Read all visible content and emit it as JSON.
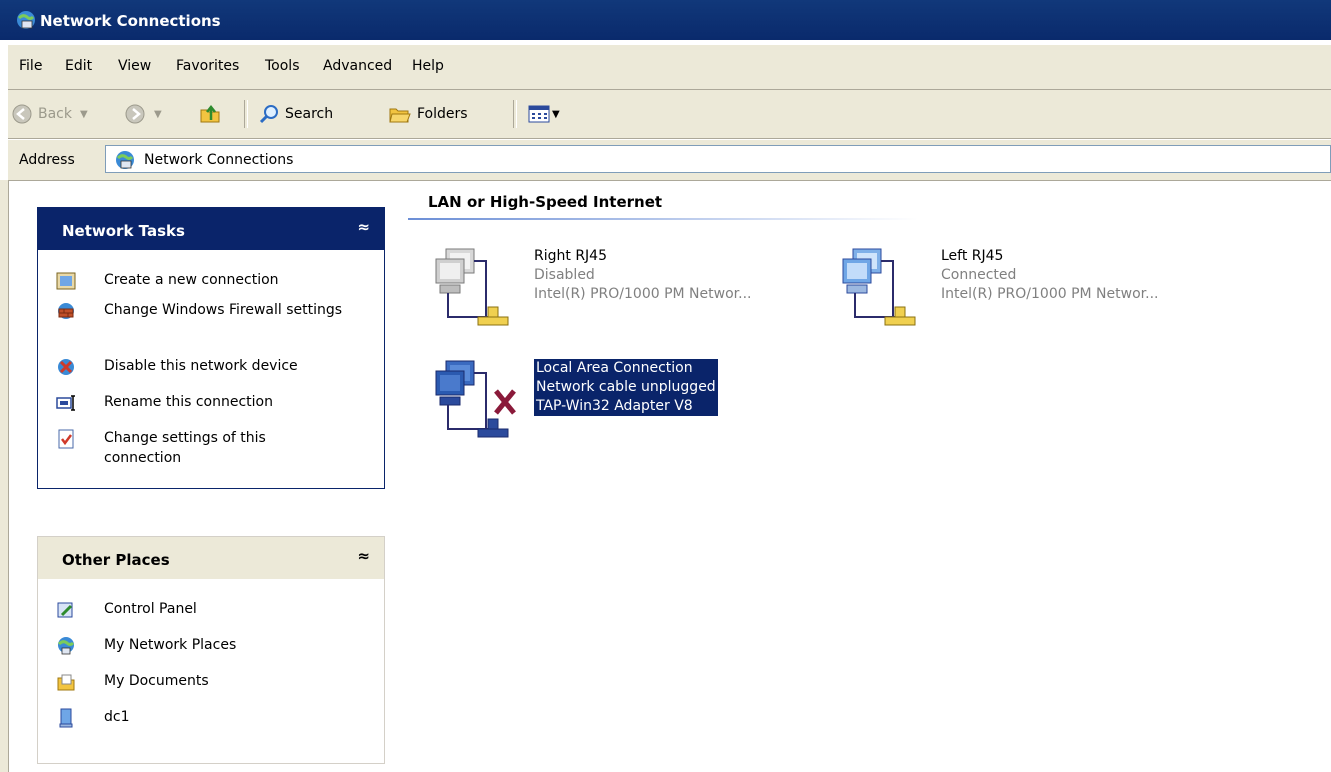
{
  "window": {
    "title": "Network Connections",
    "icon": "network-connections-icon"
  },
  "menu": {
    "items": [
      "File",
      "Edit",
      "View",
      "Favorites",
      "Tools",
      "Advanced",
      "Help"
    ]
  },
  "toolbar": {
    "back_label": "Back",
    "search_label": "Search",
    "folders_label": "Folders"
  },
  "address": {
    "label": "Address",
    "value": "Network Connections"
  },
  "sidebar": {
    "network_tasks": {
      "title": "Network Tasks",
      "items": [
        {
          "label": "Create a new connection",
          "icon": "new-connection-icon"
        },
        {
          "label": "Change Windows Firewall settings",
          "icon": "firewall-icon"
        },
        {
          "label": "Disable this network device",
          "icon": "disable-device-icon"
        },
        {
          "label": "Rename this connection",
          "icon": "rename-icon"
        },
        {
          "label": "Change settings of this connection",
          "icon": "settings-icon"
        }
      ]
    },
    "other_places": {
      "title": "Other Places",
      "items": [
        {
          "label": "Control Panel",
          "icon": "control-panel-icon"
        },
        {
          "label": "My Network Places",
          "icon": "network-places-icon"
        },
        {
          "label": "My Documents",
          "icon": "documents-icon"
        },
        {
          "label": "dc1",
          "icon": "computer-icon"
        }
      ]
    }
  },
  "main": {
    "group_title": "LAN or High-Speed Internet",
    "connections": [
      {
        "name": "Right RJ45",
        "status": "Disabled",
        "device": "Intel(R) PRO/1000 PM Networ...",
        "icon": "lan-disabled-icon"
      },
      {
        "name": "Left RJ45",
        "status": "Connected",
        "device": "Intel(R) PRO/1000 PM Networ...",
        "icon": "lan-connected-icon"
      },
      {
        "name": "Local Area Connection",
        "status": "Network cable unplugged",
        "device": "TAP-Win32 Adapter V8",
        "icon": "lan-unplugged-icon"
      }
    ]
  },
  "colors": {
    "titlebar": "#0a2a6c",
    "chrome": "#ece9d8",
    "task_header": "#0a246a",
    "selection": "#0a246a"
  }
}
